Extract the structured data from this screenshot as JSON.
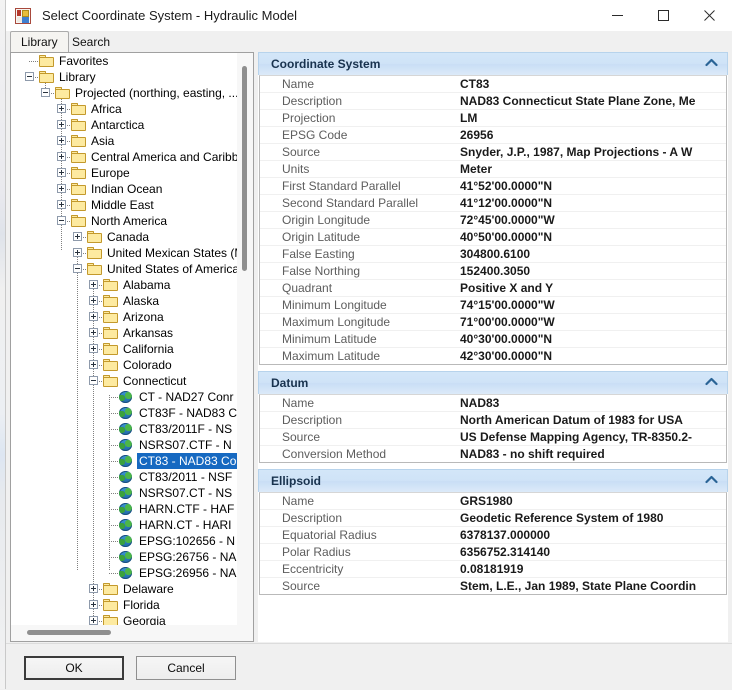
{
  "window": {
    "title": "Select Coordinate System - Hydraulic Model",
    "icon": "application-icon",
    "controls": {
      "minimize": "minimize-icon",
      "maximize": "maximize-icon",
      "close": "close-icon"
    }
  },
  "tabs": [
    {
      "label": "Library",
      "active": true
    },
    {
      "label": "Search",
      "active": false
    }
  ],
  "tree": {
    "nodes": [
      {
        "label": "Favorites",
        "depth": 1,
        "icon": "folder",
        "twisty": "none",
        "selected": false
      },
      {
        "label": "Library",
        "depth": 1,
        "icon": "folder",
        "twisty": "minus",
        "selected": false
      },
      {
        "label": "Projected (northing, easting, ...)",
        "depth": 2,
        "icon": "folder",
        "twisty": "minus",
        "selected": false
      },
      {
        "label": "Africa",
        "depth": 3,
        "icon": "folder",
        "twisty": "plus",
        "selected": false
      },
      {
        "label": "Antarctica",
        "depth": 3,
        "icon": "folder",
        "twisty": "plus",
        "selected": false
      },
      {
        "label": "Asia",
        "depth": 3,
        "icon": "folder",
        "twisty": "plus",
        "selected": false
      },
      {
        "label": "Central America and Caribbean",
        "depth": 3,
        "icon": "folder",
        "twisty": "plus",
        "selected": false
      },
      {
        "label": "Europe",
        "depth": 3,
        "icon": "folder",
        "twisty": "plus",
        "selected": false
      },
      {
        "label": "Indian Ocean",
        "depth": 3,
        "icon": "folder",
        "twisty": "plus",
        "selected": false
      },
      {
        "label": "Middle East",
        "depth": 3,
        "icon": "folder",
        "twisty": "plus",
        "selected": false
      },
      {
        "label": "North America",
        "depth": 3,
        "icon": "folder",
        "twisty": "minus",
        "selected": false
      },
      {
        "label": "Canada",
        "depth": 4,
        "icon": "folder",
        "twisty": "plus",
        "selected": false
      },
      {
        "label": "United Mexican States (M",
        "depth": 4,
        "icon": "folder",
        "twisty": "plus",
        "selected": false
      },
      {
        "label": "United States of America",
        "depth": 4,
        "icon": "folder",
        "twisty": "minus",
        "selected": false
      },
      {
        "label": "Alabama",
        "depth": 5,
        "icon": "folder",
        "twisty": "plus",
        "selected": false
      },
      {
        "label": "Alaska",
        "depth": 5,
        "icon": "folder",
        "twisty": "plus",
        "selected": false
      },
      {
        "label": "Arizona",
        "depth": 5,
        "icon": "folder",
        "twisty": "plus",
        "selected": false
      },
      {
        "label": "Arkansas",
        "depth": 5,
        "icon": "folder",
        "twisty": "plus",
        "selected": false
      },
      {
        "label": "California",
        "depth": 5,
        "icon": "folder",
        "twisty": "plus",
        "selected": false
      },
      {
        "label": "Colorado",
        "depth": 5,
        "icon": "folder",
        "twisty": "plus",
        "selected": false
      },
      {
        "label": "Connecticut",
        "depth": 5,
        "icon": "folder",
        "twisty": "minus",
        "selected": false
      },
      {
        "label": "CT - NAD27 Conr",
        "depth": 6,
        "icon": "globe",
        "twisty": "none",
        "selected": false
      },
      {
        "label": "CT83F - NAD83 C",
        "depth": 6,
        "icon": "globe",
        "twisty": "none",
        "selected": false
      },
      {
        "label": "CT83/2011F - NS",
        "depth": 6,
        "icon": "globe",
        "twisty": "none",
        "selected": false
      },
      {
        "label": "NSRS07.CTF - N",
        "depth": 6,
        "icon": "globe",
        "twisty": "none",
        "selected": false
      },
      {
        "label": "CT83 - NAD83 Co",
        "depth": 6,
        "icon": "globe",
        "twisty": "none",
        "selected": true
      },
      {
        "label": "CT83/2011 - NSF",
        "depth": 6,
        "icon": "globe",
        "twisty": "none",
        "selected": false
      },
      {
        "label": "NSRS07.CT - NS",
        "depth": 6,
        "icon": "globe",
        "twisty": "none",
        "selected": false
      },
      {
        "label": "HARN.CTF - HAF",
        "depth": 6,
        "icon": "globe",
        "twisty": "none",
        "selected": false
      },
      {
        "label": "HARN.CT - HARI",
        "depth": 6,
        "icon": "globe",
        "twisty": "none",
        "selected": false
      },
      {
        "label": "EPSG:102656 - N",
        "depth": 6,
        "icon": "globe",
        "twisty": "none",
        "selected": false
      },
      {
        "label": "EPSG:26756 - NA",
        "depth": 6,
        "icon": "globe",
        "twisty": "none",
        "selected": false
      },
      {
        "label": "EPSG:26956 - NA",
        "depth": 6,
        "icon": "globe",
        "twisty": "none",
        "selected": false
      },
      {
        "label": "Delaware",
        "depth": 5,
        "icon": "folder",
        "twisty": "plus",
        "selected": false
      },
      {
        "label": "Florida",
        "depth": 5,
        "icon": "folder",
        "twisty": "plus",
        "selected": false
      },
      {
        "label": "Georgia",
        "depth": 5,
        "icon": "folder",
        "twisty": "plus",
        "selected": false
      }
    ]
  },
  "details": {
    "sections": [
      {
        "title": "Coordinate System",
        "chevron": "chevron-up-icon",
        "rows": [
          {
            "key": "Name",
            "value": "CT83"
          },
          {
            "key": "Description",
            "value": "NAD83 Connecticut State Plane Zone, Me"
          },
          {
            "key": "Projection",
            "value": "LM"
          },
          {
            "key": "EPSG Code",
            "value": "26956"
          },
          {
            "key": "Source",
            "value": "Snyder, J.P., 1987, Map Projections - A W"
          },
          {
            "key": "Units",
            "value": "Meter"
          },
          {
            "key": "First Standard Parallel",
            "value": "41°52'00.0000\"N"
          },
          {
            "key": "Second Standard Parallel",
            "value": "41°12'00.0000\"N"
          },
          {
            "key": "Origin Longitude",
            "value": "72°45'00.0000\"W"
          },
          {
            "key": "Origin Latitude",
            "value": "40°50'00.0000\"N"
          },
          {
            "key": "False Easting",
            "value": "304800.6100"
          },
          {
            "key": "False Northing",
            "value": "152400.3050"
          },
          {
            "key": "Quadrant",
            "value": "Positive X and Y"
          },
          {
            "key": "Minimum Longitude",
            "value": "74°15'00.0000\"W"
          },
          {
            "key": "Maximum Longitude",
            "value": "71°00'00.0000\"W"
          },
          {
            "key": "Minimum Latitude",
            "value": "40°30'00.0000\"N"
          },
          {
            "key": "Maximum Latitude",
            "value": "42°30'00.0000\"N"
          }
        ]
      },
      {
        "title": "Datum",
        "chevron": "chevron-up-icon",
        "rows": [
          {
            "key": "Name",
            "value": "NAD83"
          },
          {
            "key": "Description",
            "value": "North American Datum of 1983 for USA"
          },
          {
            "key": "Source",
            "value": "US Defense Mapping Agency, TR-8350.2-"
          },
          {
            "key": "Conversion Method",
            "value": "NAD83 - no shift required"
          }
        ]
      },
      {
        "title": "Ellipsoid",
        "chevron": "chevron-up-icon",
        "rows": [
          {
            "key": "Name",
            "value": "GRS1980"
          },
          {
            "key": "Description",
            "value": "Geodetic Reference System of 1980"
          },
          {
            "key": "Equatorial Radius",
            "value": "6378137.000000"
          },
          {
            "key": "Polar Radius",
            "value": "6356752.314140"
          },
          {
            "key": "Eccentricity",
            "value": "0.08181919"
          },
          {
            "key": "Source",
            "value": "Stem, L.E., Jan 1989, State Plane Coordin"
          }
        ]
      }
    ]
  },
  "footer": {
    "ok_label": "OK",
    "cancel_label": "Cancel"
  },
  "colors": {
    "selection": "#1669c1",
    "section_header": "#cfe3f7",
    "section_title": "#18324e"
  }
}
